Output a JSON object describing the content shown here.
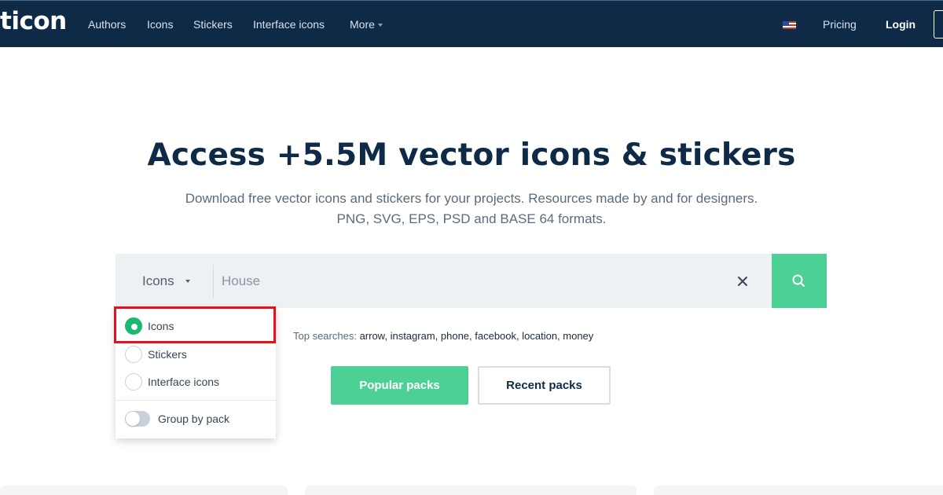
{
  "header": {
    "logo_text": "ticon",
    "nav": [
      "Authors",
      "Icons",
      "Stickers",
      "Interface icons",
      "More"
    ],
    "pricing": "Pricing",
    "login": "Login"
  },
  "hero": {
    "title": "Access +5.5M vector icons & stickers",
    "subtitle_line1": "Download free vector icons and stickers for your projects. Resources made by and for designers.",
    "subtitle_line2": "PNG, SVG, EPS, PSD and BASE 64 formats."
  },
  "search": {
    "type_selected": "Icons",
    "placeholder": "House",
    "value": "",
    "clear_icon": "close-icon",
    "search_icon": "search-icon"
  },
  "dropdown": {
    "options": [
      {
        "label": "Icons",
        "checked": true
      },
      {
        "label": "Stickers",
        "checked": false
      },
      {
        "label": "Interface icons",
        "checked": false
      }
    ],
    "toggle_label": "Group by pack",
    "toggle_on": false
  },
  "top_searches": {
    "label": "Top searches:",
    "terms": "arrow, instagram, phone, facebook, location, money"
  },
  "packs": {
    "popular": "Popular packs",
    "recent": "Recent packs"
  },
  "colors": {
    "nav_bg": "#0e2a47",
    "accent_green": "#4cd096",
    "radio_green": "#1cb770",
    "highlight_red": "#e2131c"
  }
}
